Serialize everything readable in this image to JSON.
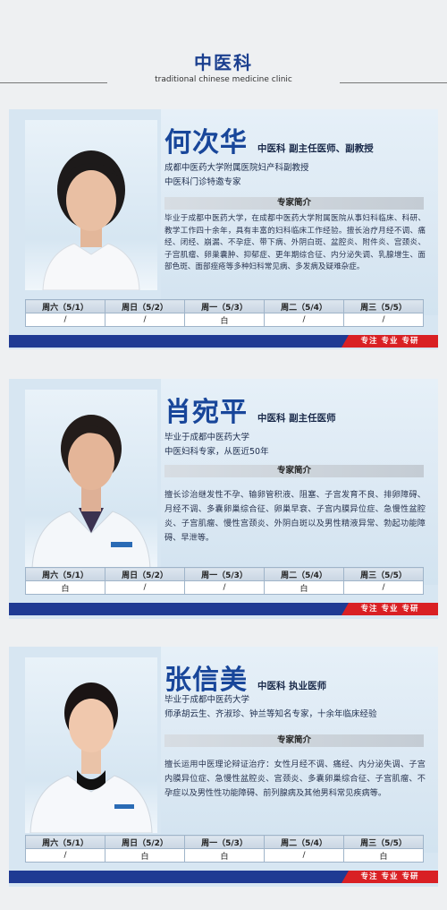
{
  "header": {
    "title": "中医科",
    "subtitle": "traditional chinese medicine clinic"
  },
  "intro_label": "专家简介",
  "slogan": "专注  专业  专研",
  "doctors": [
    {
      "name": "何次华",
      "title": "中医科    副主任医师、副教授",
      "lines": [
        "成都中医药大学附属医院妇产科副教授",
        "中医科门诊特邀专家"
      ],
      "intro": "毕业于成都中医药大学，在成都中医药大学附属医院从事妇科临床、科研、教学工作四十余年，具有丰富的妇科临床工作经验。擅长治疗月经不调、痛经、闭经、崩漏、不孕症、带下病、外阴白斑、盆腔炎、附件炎、宫颈炎、子宫肌瘤、卵巢囊肿、抑郁症、更年期综合征、内分泌失调、乳腺增生、面部色斑、面部痤疮等多种妇科常见病、多发病及疑难杂症。",
      "schedule": {
        "days": [
          "周六（5/1）",
          "周日（5/2）",
          "周一（5/3）",
          "周二（5/4）",
          "周三（5/5）"
        ],
        "values": [
          "/",
          "/",
          "白",
          "/",
          "/"
        ]
      }
    },
    {
      "name": "肖宛平",
      "title": "中医科    副主任医师",
      "lines": [
        "毕业于成都中医药大学",
        "中医妇科专家，从医近50年"
      ],
      "intro": "擅长诊治继发性不孕、输卵管积液、阻塞、子宫发育不良、排卵障碍、月经不调、多囊卵巢综合征、卵巢早衰、子宫内膜异位症、急慢性盆腔炎、子宫肌瘤、慢性宫颈炎、外阴白斑以及男性精液异常、勃起功能障碍、早泄等。",
      "schedule": {
        "days": [
          "周六（5/1）",
          "周日（5/2）",
          "周一（5/3）",
          "周二（5/4）",
          "周三（5/5）"
        ],
        "values": [
          "白",
          "/",
          "/",
          "白",
          "/"
        ]
      }
    },
    {
      "name": "张信美",
      "title": "中医科    执业医师",
      "lines": [
        "毕业于成都中医药大学",
        "师承胡云生、齐淑珍、钟兰等知名专家，十余年临床经验"
      ],
      "intro": "擅长运用中医理论辩证治疗：女性月经不调、痛经、内分泌失调、子宫内膜异位症、急慢性盆腔炎、宫颈炎、多囊卵巢综合征、子宫肌瘤、不孕症以及男性性功能障碍、前列腺病及其他男科常见疾病等。",
      "schedule": {
        "days": [
          "周六（5/1）",
          "周日（5/2）",
          "周一（5/3）",
          "周二（5/4）",
          "周三（5/5）"
        ],
        "values": [
          "/",
          "白",
          "白",
          "/",
          "白"
        ]
      }
    }
  ]
}
